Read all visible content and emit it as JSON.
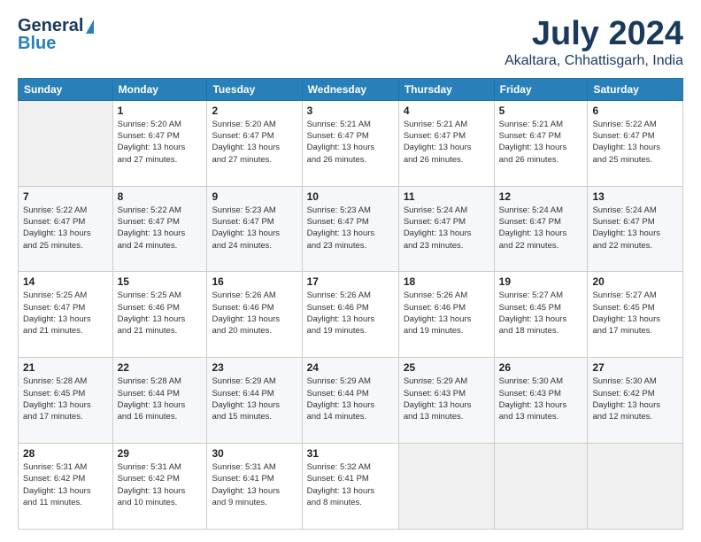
{
  "logo": {
    "line1": "General",
    "line2": "Blue"
  },
  "title": "July 2024",
  "subtitle": "Akaltara, Chhattisgarh, India",
  "days_header": [
    "Sunday",
    "Monday",
    "Tuesday",
    "Wednesday",
    "Thursday",
    "Friday",
    "Saturday"
  ],
  "weeks": [
    [
      {
        "num": "",
        "info": ""
      },
      {
        "num": "1",
        "info": "Sunrise: 5:20 AM\nSunset: 6:47 PM\nDaylight: 13 hours\nand 27 minutes."
      },
      {
        "num": "2",
        "info": "Sunrise: 5:20 AM\nSunset: 6:47 PM\nDaylight: 13 hours\nand 27 minutes."
      },
      {
        "num": "3",
        "info": "Sunrise: 5:21 AM\nSunset: 6:47 PM\nDaylight: 13 hours\nand 26 minutes."
      },
      {
        "num": "4",
        "info": "Sunrise: 5:21 AM\nSunset: 6:47 PM\nDaylight: 13 hours\nand 26 minutes."
      },
      {
        "num": "5",
        "info": "Sunrise: 5:21 AM\nSunset: 6:47 PM\nDaylight: 13 hours\nand 26 minutes."
      },
      {
        "num": "6",
        "info": "Sunrise: 5:22 AM\nSunset: 6:47 PM\nDaylight: 13 hours\nand 25 minutes."
      }
    ],
    [
      {
        "num": "7",
        "info": "Sunrise: 5:22 AM\nSunset: 6:47 PM\nDaylight: 13 hours\nand 25 minutes."
      },
      {
        "num": "8",
        "info": "Sunrise: 5:22 AM\nSunset: 6:47 PM\nDaylight: 13 hours\nand 24 minutes."
      },
      {
        "num": "9",
        "info": "Sunrise: 5:23 AM\nSunset: 6:47 PM\nDaylight: 13 hours\nand 24 minutes."
      },
      {
        "num": "10",
        "info": "Sunrise: 5:23 AM\nSunset: 6:47 PM\nDaylight: 13 hours\nand 23 minutes."
      },
      {
        "num": "11",
        "info": "Sunrise: 5:24 AM\nSunset: 6:47 PM\nDaylight: 13 hours\nand 23 minutes."
      },
      {
        "num": "12",
        "info": "Sunrise: 5:24 AM\nSunset: 6:47 PM\nDaylight: 13 hours\nand 22 minutes."
      },
      {
        "num": "13",
        "info": "Sunrise: 5:24 AM\nSunset: 6:47 PM\nDaylight: 13 hours\nand 22 minutes."
      }
    ],
    [
      {
        "num": "14",
        "info": "Sunrise: 5:25 AM\nSunset: 6:47 PM\nDaylight: 13 hours\nand 21 minutes."
      },
      {
        "num": "15",
        "info": "Sunrise: 5:25 AM\nSunset: 6:46 PM\nDaylight: 13 hours\nand 21 minutes."
      },
      {
        "num": "16",
        "info": "Sunrise: 5:26 AM\nSunset: 6:46 PM\nDaylight: 13 hours\nand 20 minutes."
      },
      {
        "num": "17",
        "info": "Sunrise: 5:26 AM\nSunset: 6:46 PM\nDaylight: 13 hours\nand 19 minutes."
      },
      {
        "num": "18",
        "info": "Sunrise: 5:26 AM\nSunset: 6:46 PM\nDaylight: 13 hours\nand 19 minutes."
      },
      {
        "num": "19",
        "info": "Sunrise: 5:27 AM\nSunset: 6:45 PM\nDaylight: 13 hours\nand 18 minutes."
      },
      {
        "num": "20",
        "info": "Sunrise: 5:27 AM\nSunset: 6:45 PM\nDaylight: 13 hours\nand 17 minutes."
      }
    ],
    [
      {
        "num": "21",
        "info": "Sunrise: 5:28 AM\nSunset: 6:45 PM\nDaylight: 13 hours\nand 17 minutes."
      },
      {
        "num": "22",
        "info": "Sunrise: 5:28 AM\nSunset: 6:44 PM\nDaylight: 13 hours\nand 16 minutes."
      },
      {
        "num": "23",
        "info": "Sunrise: 5:29 AM\nSunset: 6:44 PM\nDaylight: 13 hours\nand 15 minutes."
      },
      {
        "num": "24",
        "info": "Sunrise: 5:29 AM\nSunset: 6:44 PM\nDaylight: 13 hours\nand 14 minutes."
      },
      {
        "num": "25",
        "info": "Sunrise: 5:29 AM\nSunset: 6:43 PM\nDaylight: 13 hours\nand 13 minutes."
      },
      {
        "num": "26",
        "info": "Sunrise: 5:30 AM\nSunset: 6:43 PM\nDaylight: 13 hours\nand 13 minutes."
      },
      {
        "num": "27",
        "info": "Sunrise: 5:30 AM\nSunset: 6:42 PM\nDaylight: 13 hours\nand 12 minutes."
      }
    ],
    [
      {
        "num": "28",
        "info": "Sunrise: 5:31 AM\nSunset: 6:42 PM\nDaylight: 13 hours\nand 11 minutes."
      },
      {
        "num": "29",
        "info": "Sunrise: 5:31 AM\nSunset: 6:42 PM\nDaylight: 13 hours\nand 10 minutes."
      },
      {
        "num": "30",
        "info": "Sunrise: 5:31 AM\nSunset: 6:41 PM\nDaylight: 13 hours\nand 9 minutes."
      },
      {
        "num": "31",
        "info": "Sunrise: 5:32 AM\nSunset: 6:41 PM\nDaylight: 13 hours\nand 8 minutes."
      },
      {
        "num": "",
        "info": ""
      },
      {
        "num": "",
        "info": ""
      },
      {
        "num": "",
        "info": ""
      }
    ]
  ]
}
